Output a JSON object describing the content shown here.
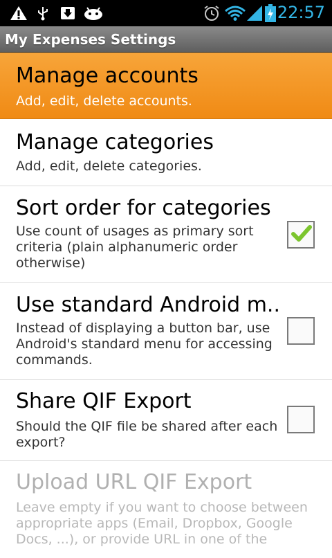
{
  "status_bar": {
    "time": "22:57",
    "icons": [
      "warning-icon",
      "usb-icon",
      "download-icon",
      "android-debug-icon",
      "alarm-icon",
      "wifi-icon",
      "signal-icon",
      "battery-charging-icon"
    ],
    "accent_color": "#33b5e5"
  },
  "app_bar": {
    "title": "My Expenses Settings"
  },
  "preferences": [
    {
      "title": "Manage accounts",
      "summary": "Add, edit, delete accounts.",
      "selected": true
    },
    {
      "title": "Manage categories",
      "summary": "Add, edit, delete categories."
    },
    {
      "title": "Sort order for categories",
      "summary_lines": [
        "Use count of usages as primary sort",
        "criteria (plain alphanumeric order",
        "otherwise)"
      ],
      "checked": true
    },
    {
      "title": "Use standard Android m..",
      "summary_lines": [
        "Instead of displaying a button bar, use",
        "Android's standard menu for accessing",
        "commands."
      ],
      "checked": false
    },
    {
      "title": "Share QIF Export",
      "summary_lines": [
        "Should the QIF file be shared after each",
        "export?"
      ],
      "checked": false
    },
    {
      "title": "Upload URL QIF Export",
      "summary_lines": [
        "Leave empty if you want to choose between",
        "appropriate apps (Email, Dropbox, Google",
        "Docs, ...), or provide URL in one of the"
      ],
      "disabled": true
    }
  ],
  "colors": {
    "selected_row": "#f39324",
    "check_green": "#7cc52e"
  }
}
